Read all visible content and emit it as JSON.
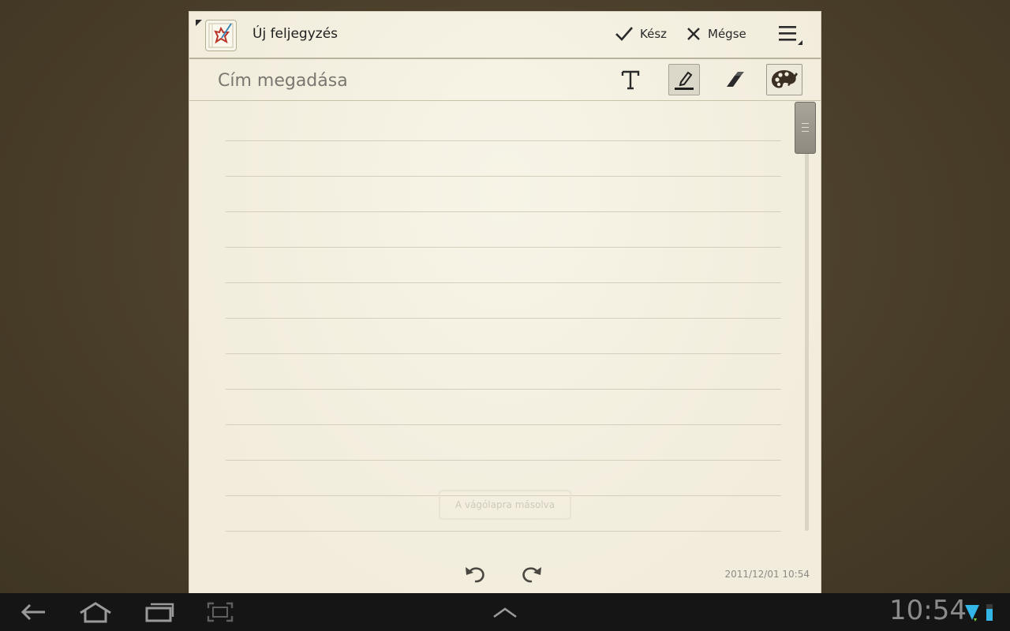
{
  "header": {
    "app_title": "Új feljegyzés",
    "done_label": "Kész",
    "cancel_label": "Mégse"
  },
  "toolbar": {
    "title_placeholder": "Cím megadása",
    "tools": [
      "text-tool",
      "pen-tool",
      "eraser-tool",
      "palette-tool"
    ],
    "active_tool": "pen-tool"
  },
  "note": {
    "toast": "A vágólapra másolva",
    "timestamp": "2011/12/01 10:54"
  },
  "system_bar": {
    "clock": "10:54"
  },
  "colors": {
    "paper": "#f4f0e1",
    "desk": "#4a3f2b",
    "navbar": "#151515"
  }
}
